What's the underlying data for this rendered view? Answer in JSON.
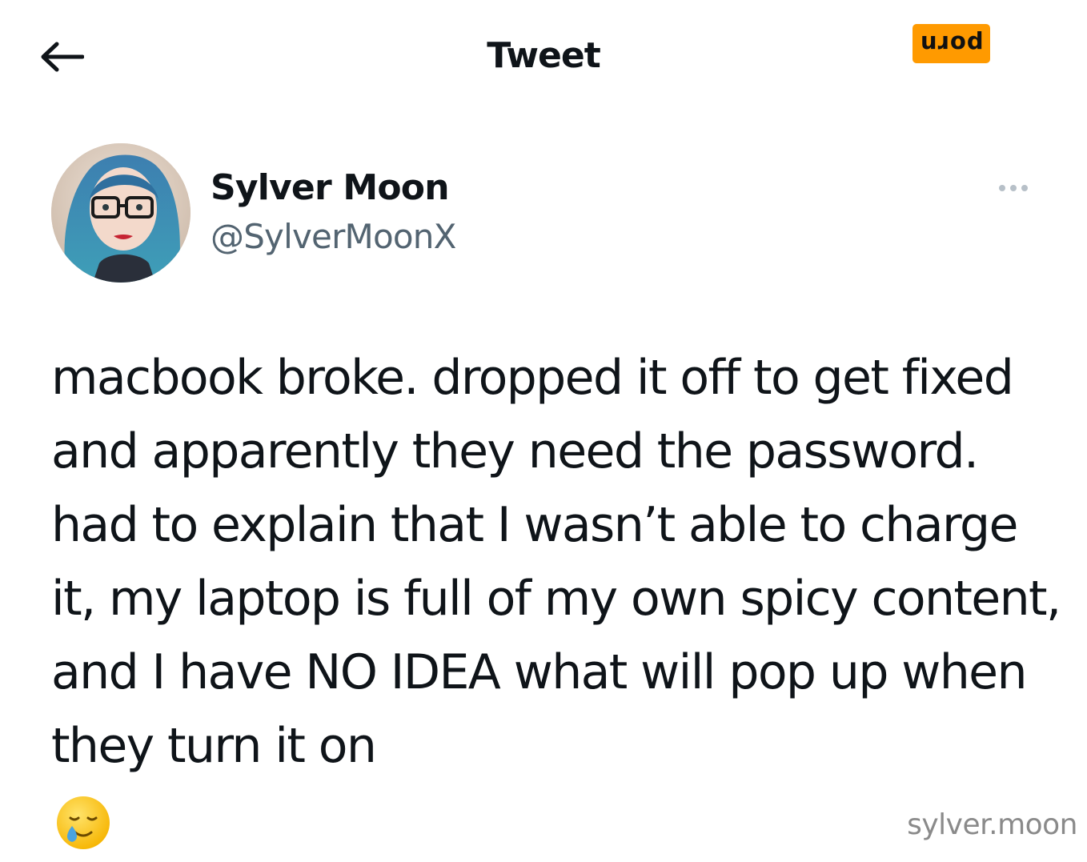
{
  "header": {
    "back_icon": "arrow-left-icon",
    "title": "Tweet",
    "watermark_badge": "porn",
    "badge_color": "#ff9a00"
  },
  "tweet": {
    "avatar_alt": "profile-photo",
    "display_name": "Sylver Moon",
    "handle": "@SylverMoonX",
    "more_icon": "more-dots-icon",
    "text": "macbook broke. dropped it off to get fixed and apparently they need the password. had to explain that I wasn’t able to charge it, my laptop is full of my own spicy content, and I have NO IDEA what will pop up when they turn it on",
    "emoji": "smiling-face-with-tear-icon"
  },
  "credit": "sylver.moon",
  "colors": {
    "text": "#0f1419",
    "secondary_text": "#536471",
    "credit_text": "#8a8a8a",
    "background": "#ffffff"
  }
}
